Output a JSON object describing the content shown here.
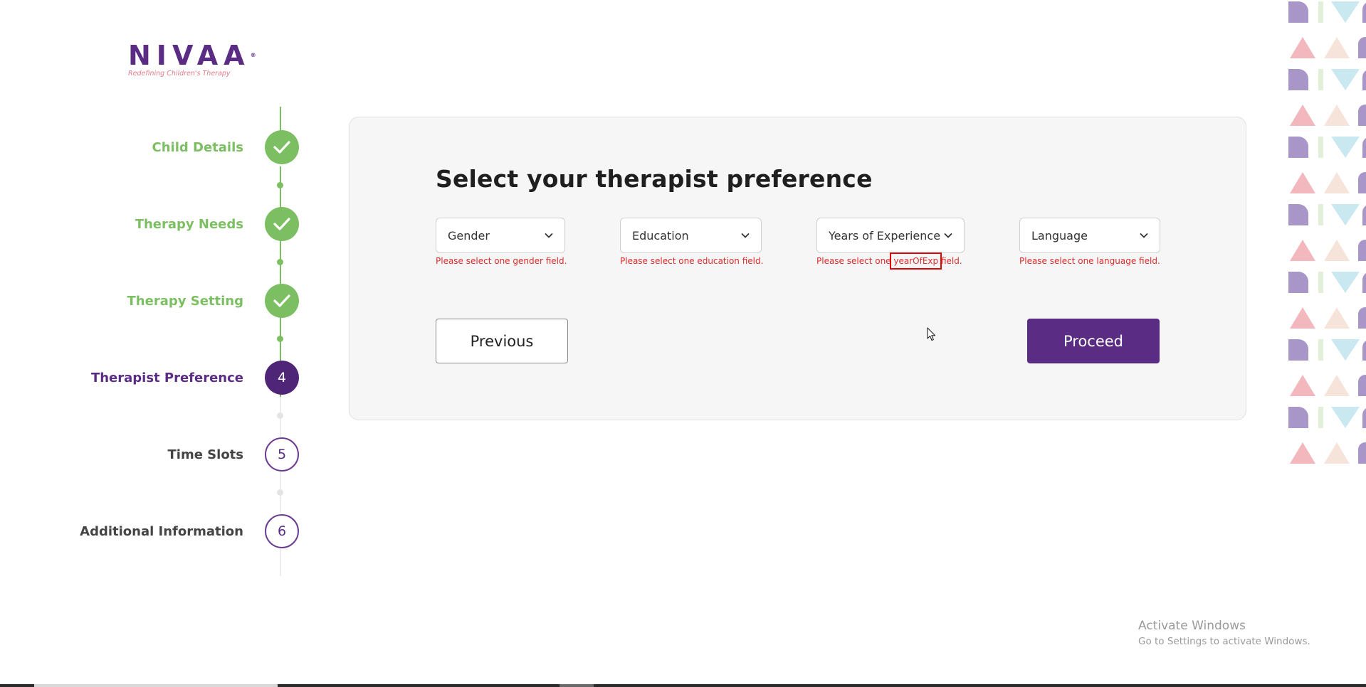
{
  "brand": {
    "name": "NIVAA",
    "tagline": "Redefining Children's Therapy"
  },
  "stepper": {
    "steps": [
      {
        "label": "Child Details",
        "state": "done"
      },
      {
        "label": "Therapy Needs",
        "state": "done"
      },
      {
        "label": "Therapy Setting",
        "state": "done"
      },
      {
        "label": "Therapist Preference",
        "state": "current",
        "number": "4"
      },
      {
        "label": "Time Slots",
        "state": "todo",
        "number": "5"
      },
      {
        "label": "Additional Information",
        "state": "todo",
        "number": "6"
      }
    ]
  },
  "form": {
    "title": "Select your therapist preference",
    "fields": [
      {
        "label": "Gender",
        "error_before": "Please select one gender field.",
        "error_highlight": "",
        "error_after": ""
      },
      {
        "label": "Education",
        "error_before": "Please select one education field.",
        "error_highlight": "",
        "error_after": ""
      },
      {
        "label": "Years of Experience",
        "error_before": "Please select one ",
        "error_highlight": "yearOfExp",
        "error_after": " field."
      },
      {
        "label": "Language",
        "error_before": "Please select one language field.",
        "error_highlight": "",
        "error_after": ""
      }
    ],
    "previous_label": "Previous",
    "proceed_label": "Proceed"
  },
  "watermark": {
    "title": "Activate Windows",
    "subtitle": "Go to Settings to activate Windows."
  },
  "colors": {
    "brand_purple": "#5b2c83",
    "done_green": "#7cbf62",
    "error_red": "#e12a2a"
  }
}
